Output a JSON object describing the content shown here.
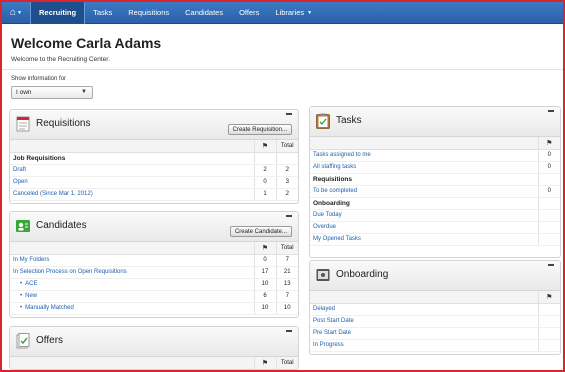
{
  "nav": {
    "items": [
      {
        "label": "Recruiting",
        "active": true
      },
      {
        "label": "Tasks"
      },
      {
        "label": "Requisitions"
      },
      {
        "label": "Candidates"
      },
      {
        "label": "Offers"
      },
      {
        "label": "Libraries"
      }
    ]
  },
  "header": {
    "title": "Welcome Carla Adams",
    "subtitle": "Welcome to the Recruiting Center."
  },
  "filter": {
    "label": "Show information for",
    "selected": "I own"
  },
  "requisitions": {
    "title": "Requisitions",
    "button": "Create Requisition...",
    "total_header": "Total",
    "section": "Job Requisitions",
    "rows": [
      {
        "label": "Draft",
        "flag": "2",
        "total": "2"
      },
      {
        "label": "Open",
        "flag": "0",
        "total": "3"
      },
      {
        "label": "Canceled (Since Mar 1, 2012)",
        "flag": "1",
        "total": "2"
      }
    ]
  },
  "candidates": {
    "title": "Candidates",
    "button": "Create Candidate...",
    "total_header": "Total",
    "rows": [
      {
        "label": "In My Folders",
        "flag": "0",
        "total": "7"
      },
      {
        "label": "In Selection Process on Open Requisitions",
        "flag": "17",
        "total": "21"
      },
      {
        "label": "ACE",
        "flag": "10",
        "total": "13"
      },
      {
        "label": "New",
        "flag": "6",
        "total": "7"
      },
      {
        "label": "Manually Matched",
        "flag": "10",
        "total": "10"
      }
    ]
  },
  "offers": {
    "title": "Offers",
    "total_header": "Total"
  },
  "tasks": {
    "title": "Tasks",
    "rows": [
      {
        "label": "Tasks assigned to me",
        "value": "0"
      },
      {
        "label": "All staffing tasks",
        "value": "0"
      }
    ],
    "req_section": "Requisitions",
    "req_rows": [
      {
        "label": "To be completed",
        "value": "0"
      }
    ],
    "onb_section": "Onboarding",
    "onb_rows": [
      {
        "label": "Due Today"
      },
      {
        "label": "Overdue"
      },
      {
        "label": "My Opened Tasks"
      }
    ]
  },
  "onboarding": {
    "title": "Onboarding",
    "rows": [
      {
        "label": "Delayed"
      },
      {
        "label": "Post Start Date"
      },
      {
        "label": "Pre Start Date"
      },
      {
        "label": "In Progress"
      }
    ]
  },
  "colors": {
    "nav_bg": "#2a60a6",
    "link": "#1f5fae",
    "frame": "#d9262c"
  }
}
